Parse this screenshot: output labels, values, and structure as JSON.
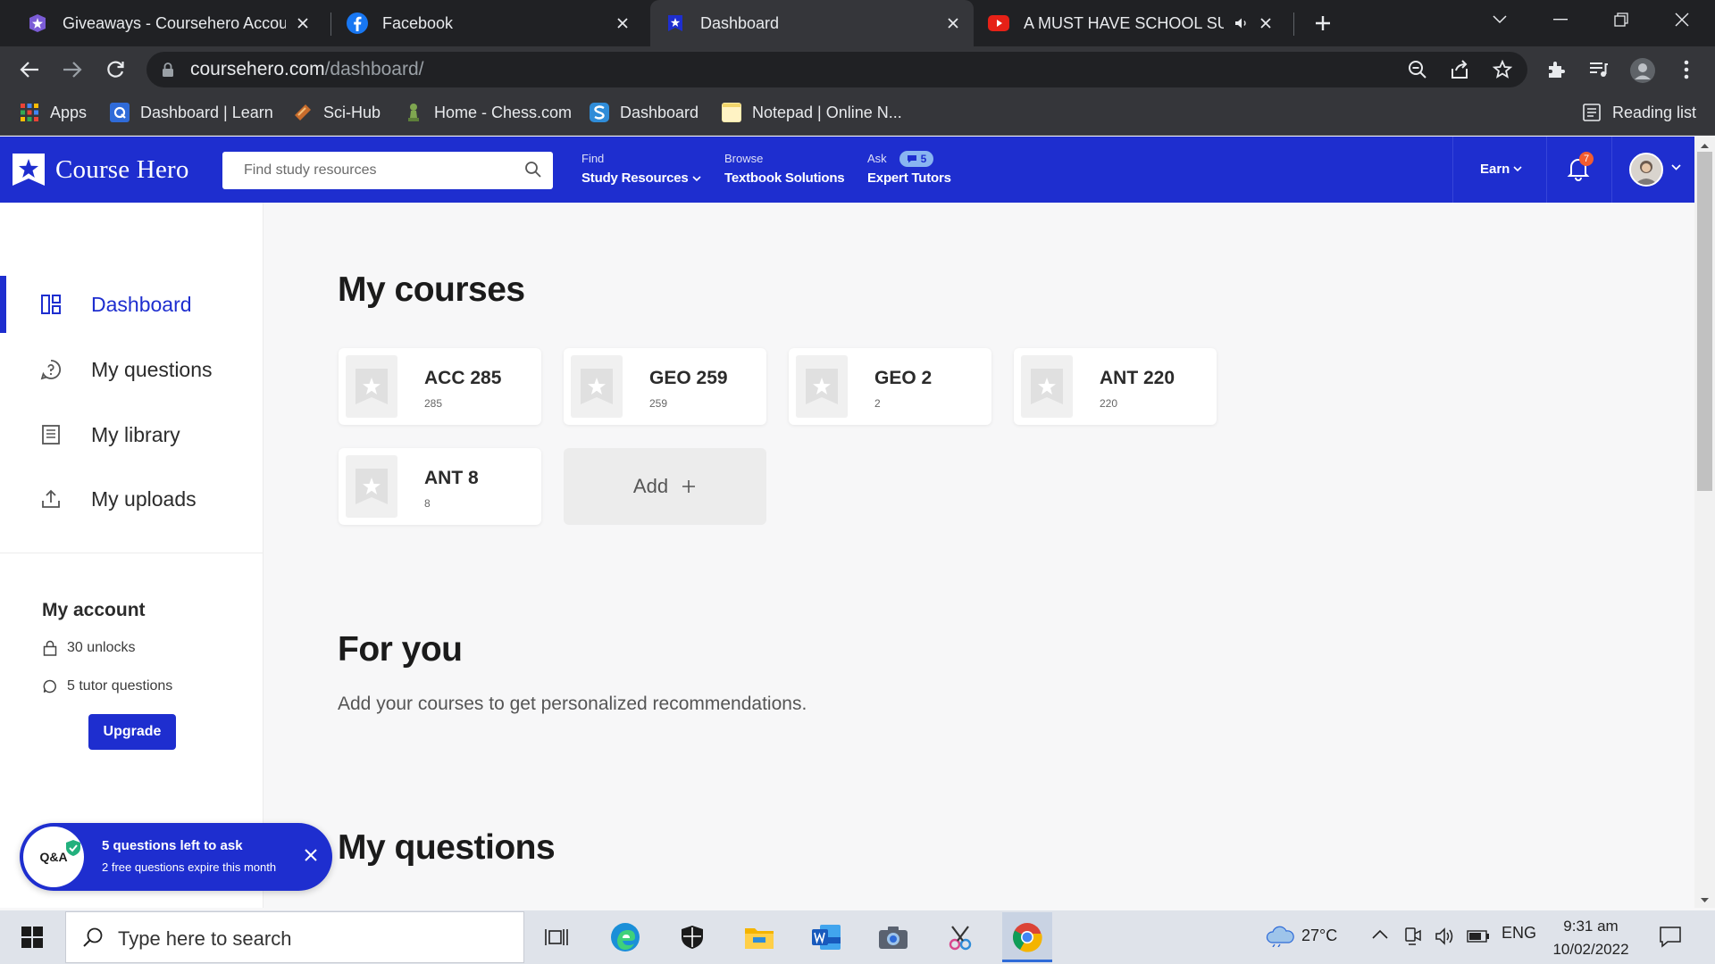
{
  "browser": {
    "tabs": [
      {
        "title": "Giveaways - Coursehero Account"
      },
      {
        "title": "Facebook"
      },
      {
        "title": "Dashboard"
      },
      {
        "title": "A MUST HAVE SCHOOL SUPPLIES"
      }
    ],
    "url_domain": "coursehero.com",
    "url_path": "/dashboard/",
    "bookmarks": [
      {
        "label": "Apps"
      },
      {
        "label": "Dashboard | Learn"
      },
      {
        "label": "Sci-Hub"
      },
      {
        "label": "Home - Chess.com"
      },
      {
        "label": "Dashboard"
      },
      {
        "label": "Notepad | Online N..."
      }
    ],
    "reading_list": "Reading list"
  },
  "header": {
    "brand": "Course Hero",
    "search_placeholder": "Find study resources",
    "nav": [
      {
        "small": "Find",
        "label": "Study Resources"
      },
      {
        "small": "Browse",
        "label": "Textbook Solutions"
      },
      {
        "small": "Ask",
        "label": "Expert Tutors",
        "pill": "5"
      }
    ],
    "earn": "Earn",
    "notification_count": "7"
  },
  "sidebar": {
    "items": [
      {
        "label": "Dashboard",
        "active": true
      },
      {
        "label": "My questions"
      },
      {
        "label": "My library"
      },
      {
        "label": "My uploads"
      }
    ],
    "account_title": "My account",
    "unlocks": "30 unlocks",
    "tutor_questions": "5 tutor questions",
    "upgrade": "Upgrade"
  },
  "main": {
    "courses_title": "My courses",
    "courses": [
      {
        "code": "ACC 285",
        "num": "285"
      },
      {
        "code": "GEO 259",
        "num": "259"
      },
      {
        "code": "GEO 2",
        "num": "2"
      },
      {
        "code": "ANT 220",
        "num": "220"
      },
      {
        "code": "ANT 8",
        "num": "8"
      }
    ],
    "add_label": "Add",
    "foryou_title": "For you",
    "foryou_sub": "Add your courses to get personalized recommendations.",
    "questions_title": "My questions"
  },
  "toast": {
    "badge": "Q&A",
    "title": "5 questions left to ask",
    "subtitle": "2 free questions expire this month"
  },
  "taskbar": {
    "search_placeholder": "Type here to search",
    "temperature": "27°C",
    "language": "ENG",
    "time": "9:31 am",
    "date": "10/02/2022"
  },
  "colors": {
    "brand": "#1e2ecf",
    "chrome_dark": "#202124",
    "chrome_toolbar": "#35363a"
  }
}
